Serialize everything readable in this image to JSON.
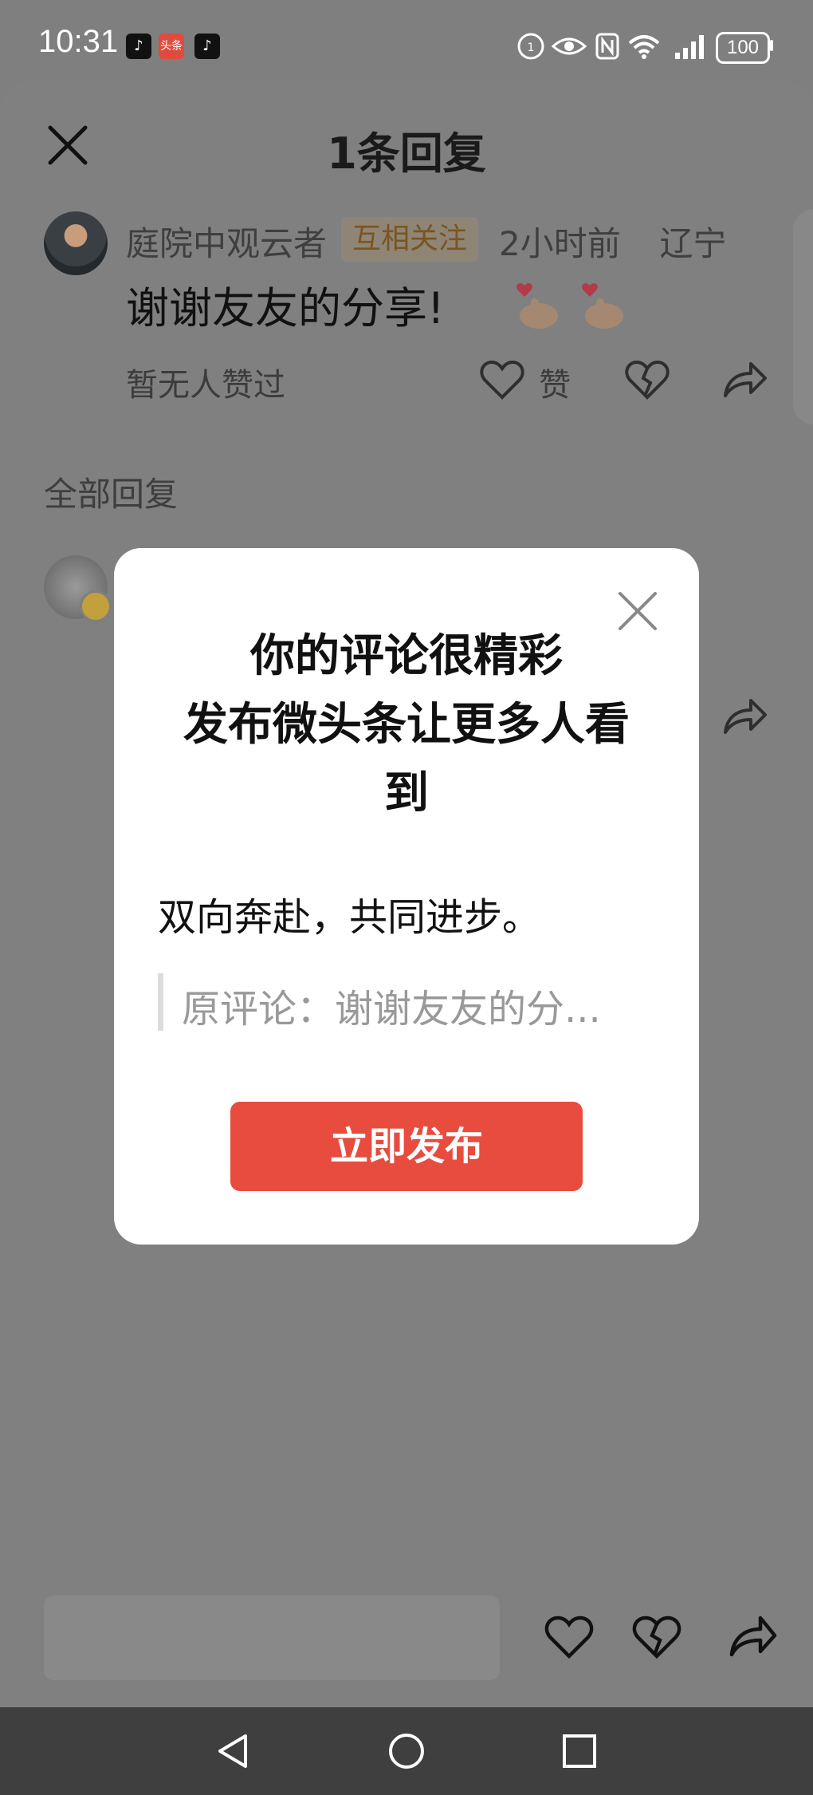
{
  "status_bar": {
    "time": "10:31",
    "app_icons": [
      "tiktok-icon",
      "toutiao-icon",
      "tiktok-lite-icon"
    ],
    "toutiao_label": "头条",
    "battery": "100"
  },
  "header": {
    "title": "1条回复",
    "close_icon": "close-icon"
  },
  "comment": {
    "author": "庭院中观云者",
    "relation_badge": "互相关注",
    "time": "2小时前",
    "location": "辽宁",
    "text": "谢谢友友的分享!",
    "likes_text": "暂无人赞过",
    "like_label": "赞"
  },
  "replies_section": {
    "title": "全部回复"
  },
  "modal": {
    "title_lines": [
      "你的评论很精彩",
      "发布微头条让更多人看",
      "到"
    ],
    "subtitle": "双向奔赴，共同进步。",
    "quote": "原评论：谢谢友友的分...",
    "publish_label": "立即发布"
  },
  "colors": {
    "accent": "#e84c3f",
    "overlay": "#7f7f7f",
    "badge_text": "#7a5520"
  }
}
